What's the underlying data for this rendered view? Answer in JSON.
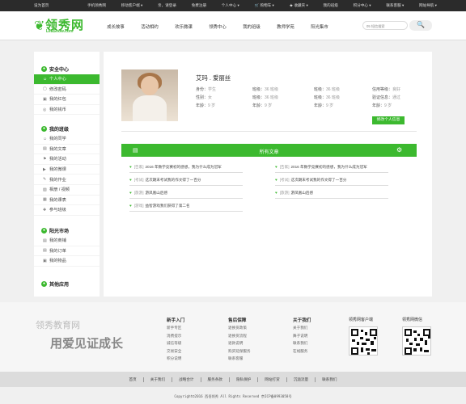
{
  "topbar": {
    "home": "设为首页",
    "links": [
      "手机领秀网",
      "移动客户端 ▾",
      "亲，请登录",
      "免费注册",
      "个人中心 ▾",
      "🛒 购物车 ▾",
      "★ 收藏夹 ▾",
      "我的班级",
      "积分中心 ▾",
      "联系客服 ▾",
      "网站导航 ▾"
    ]
  },
  "logo": {
    "text": "领秀网",
    "sub": "LeaShow.com"
  },
  "nav": [
    "成长故事",
    "活动相约",
    "欢乐微课",
    "领秀中心",
    "我的班级",
    "教师学苑",
    "阳光集市"
  ],
  "search": {
    "placeholder": "05 短信搜索",
    "button": "🔍"
  },
  "sidebar": {
    "g1": {
      "title": "安全中心",
      "items": [
        "个人中心",
        "修改密码",
        "我的红包",
        "我的钱币"
      ]
    },
    "g2": {
      "title": "我的班级",
      "items": [
        "我的同学",
        "我的文章",
        "我的活动",
        "我的微课",
        "我的作业",
        "相册 / 视频",
        "我的课表",
        "参与班级"
      ]
    },
    "g3": {
      "title": "阳光市场",
      "items": [
        "我的商铺",
        "我的订单",
        "我的物品"
      ]
    },
    "g4": {
      "title": "其他应用"
    }
  },
  "profile": {
    "name": "艾玛 . 爱丽丝",
    "identity_l": "身份：",
    "identity_v": "学生",
    "gender_l": "性别：",
    "gender_v": "女",
    "age_l": "年龄：",
    "age_v": "9 岁",
    "class_l": "班级：",
    "class_v": "36 班级",
    "class2_l": "班级：",
    "class2_v": "36 班级",
    "age2_l": "年龄：",
    "age2_v": "9 岁",
    "class3_l": "班级：",
    "class3_v": "36 班级",
    "class4_l": "班级：",
    "class4_v": "36 班级",
    "age3_l": "年龄：",
    "age3_v": "9 岁",
    "credit_l": "信用等级：",
    "credit_v": "良好",
    "verify_l": "验证信息：",
    "verify_v": "通过",
    "age4_l": "年龄：",
    "age4_v": "9 岁",
    "edit": "修改个人信息"
  },
  "articles": {
    "title": "所有文章",
    "left": [
      {
        "icon": "♥",
        "tag": "[告家]",
        "text": "2016 年数学竞赛初的感想，我为什么成为冠军"
      },
      {
        "icon": "♥",
        "tag": "[考试]",
        "text": "这次期末考试我的作文得了一百分"
      },
      {
        "icon": "♥",
        "tag": "[旅游]",
        "text": "游凤凰山后感"
      },
      {
        "icon": "♥",
        "tag": "[游戏]",
        "text": "益智游戏我们获得了第二名"
      }
    ],
    "right": [
      {
        "icon": "♥",
        "tag": "[告家]",
        "text": "2016 年数学竞赛初的感想，我为什么成为冠军"
      },
      {
        "icon": "♥",
        "tag": "[考试]",
        "text": "这次期末考试我的作文得了一百分"
      },
      {
        "icon": "♥",
        "tag": "[旅游]",
        "text": "游凤凰山后感"
      }
    ]
  },
  "footer": {
    "brand1": "领秀教育网",
    "brand2": "用爱见证成长",
    "cols": [
      {
        "title": "新手入门",
        "items": [
          "新手专区",
          "消费提示",
          "诚信等级",
          "交易安全",
          "积分说明"
        ]
      },
      {
        "title": "售后保障",
        "items": [
          "退换货政策",
          "退换货流程",
          "退款说明",
          "购买延保服务",
          "联系客服"
        ]
      },
      {
        "title": "关于我们",
        "items": [
          "关于我们",
          "舞子说明",
          "联系我们",
          "在线服务"
        ]
      }
    ],
    "qr1": "领秀网客户端",
    "qr2": "领秀网微信"
  },
  "links": [
    "首页",
    "关于我们",
    "战略合计",
    "服务条款",
    "隐私保护",
    "网站打赏",
    "沉湎流量",
    "联系我们"
  ],
  "copyright": "Copyright©2016 西佰领秀 All  Rights Reserved  京ICP备0993058号"
}
